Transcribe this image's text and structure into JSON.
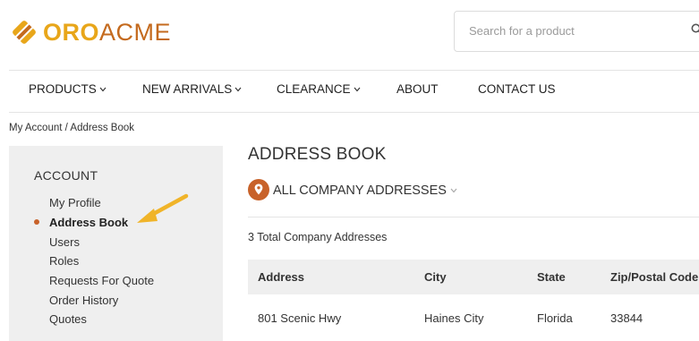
{
  "brand": {
    "part1": "ORO",
    "part2": "ACME"
  },
  "search": {
    "placeholder": "Search for a product"
  },
  "nav": {
    "products": "PRODUCTS",
    "new_arrivals": "NEW ARRIVALS",
    "clearance": "CLEARANCE",
    "about": "ABOUT",
    "contact": "CONTACT US"
  },
  "breadcrumb": "My Account / Address Book",
  "sidebar": {
    "title": "ACCOUNT",
    "items": [
      "My Profile",
      "Address Book",
      "Users",
      "Roles",
      "Requests For Quote",
      "Order History",
      "Quotes"
    ],
    "active_index": 1
  },
  "main": {
    "title": "ADDRESS BOOK",
    "filter_label": "ALL COMPANY ADDRESSES",
    "total_text": "3 Total Company Addresses",
    "columns": [
      "Address",
      "City",
      "State",
      "Zip/Postal Code"
    ],
    "rows": [
      {
        "address": "801 Scenic Hwy",
        "city": "Haines City",
        "state": "Florida",
        "zip": "33844"
      }
    ]
  },
  "colors": {
    "accent": "#c8622a",
    "brand_yellow": "#e8a61a",
    "arrow": "#f0b429"
  }
}
